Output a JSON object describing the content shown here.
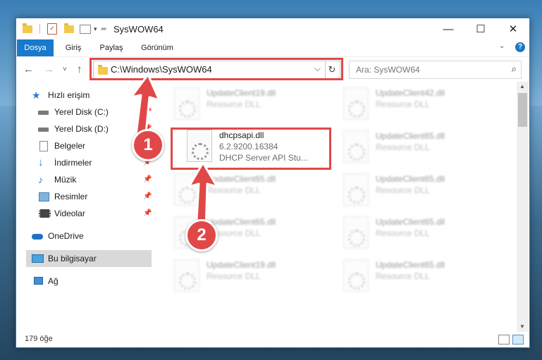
{
  "window": {
    "title": "SysWOW64",
    "controls": {
      "minimize": "—",
      "maximize": "☐",
      "close": "✕"
    }
  },
  "ribbon": {
    "tabs": [
      "Dosya",
      "Giriş",
      "Paylaş",
      "Görünüm"
    ],
    "expand_icon": "chevron-down-icon",
    "help_icon": "help-icon",
    "help_glyph": "?"
  },
  "address": {
    "path": "C:\\Windows\\SysWOW64",
    "back": "←",
    "forward": "→",
    "recent": "˅",
    "up": "↑",
    "dropdown": "⌵",
    "refresh": "↻"
  },
  "search": {
    "placeholder": "Ara: SysWOW64",
    "icon": "⌕"
  },
  "sidebar": {
    "items": [
      {
        "label": "Hızlı erişim",
        "icon": "star-icon"
      },
      {
        "label": "Yerel Disk (C:)",
        "icon": "drive-icon",
        "pinned": true
      },
      {
        "label": "Yerel Disk (D:)",
        "icon": "drive-icon",
        "pinned": true
      },
      {
        "label": "Belgeler",
        "icon": "document-icon",
        "pinned": true
      },
      {
        "label": "İndirmeler",
        "icon": "download-icon",
        "pinned": true
      },
      {
        "label": "Müzik",
        "icon": "music-icon",
        "pinned": true
      },
      {
        "label": "Resimler",
        "icon": "image-icon",
        "pinned": true
      },
      {
        "label": "Videolar",
        "icon": "video-icon",
        "pinned": true
      },
      {
        "label": "OneDrive",
        "icon": "cloud-icon"
      },
      {
        "label": "Bu bilgisayar",
        "icon": "computer-icon",
        "selected": true
      },
      {
        "label": "Ağ",
        "icon": "network-icon"
      }
    ],
    "pin_glyph": "📌"
  },
  "files": {
    "main": {
      "name": "dhcpsapi.dll",
      "version": "6.2.9200.16384",
      "description": "DHCP Server API Stu..."
    },
    "left_column": [
      {
        "name": "UpdateClient19.dll",
        "description": "Resource DLL"
      },
      {
        "name": "UpdateClient65.dll",
        "description": "Resource DLL"
      },
      {
        "name": "UpdateClient65.dll",
        "description": "Resource DLL"
      },
      {
        "name": "UpdateClient19.dll",
        "description": "Resource DLL"
      }
    ],
    "right_column": [
      {
        "name": "UpdateClient42.dll",
        "description": "Resource DLL"
      },
      {
        "name": "UpdateClient65.dll",
        "description": "Resource DLL"
      },
      {
        "name": "UpdateClient65.dll",
        "description": "Resource DLL"
      },
      {
        "name": "UpdateClient65.dll",
        "description": "Resource DLL"
      },
      {
        "name": "UpdateClient65.dll",
        "description": "Resource DLL"
      }
    ]
  },
  "status": {
    "count": "179 öğe"
  },
  "annotations": {
    "step1": "1",
    "step2": "2",
    "color": "#e04848"
  }
}
